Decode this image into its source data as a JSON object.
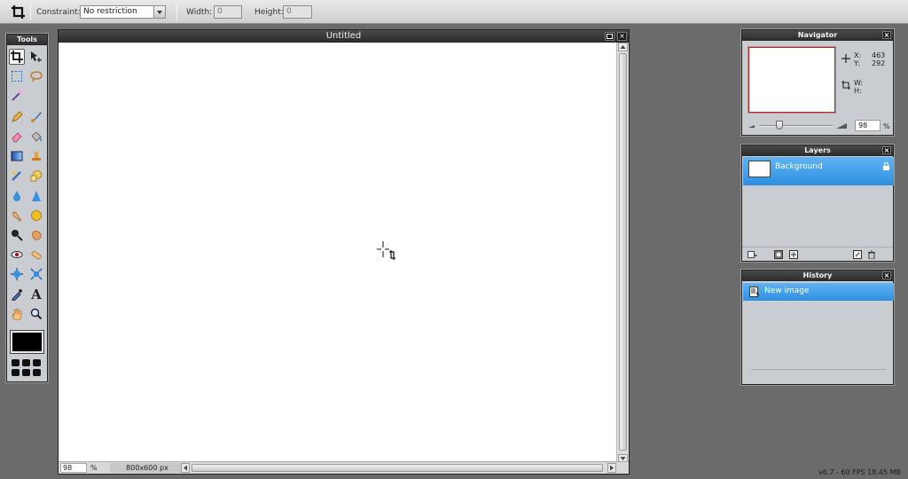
{
  "options_bar": {
    "constraint_label": "Constraint:",
    "constraint_value": "No restriction",
    "width_label": "Width:",
    "width_value": "0",
    "height_label": "Height:",
    "height_value": "0"
  },
  "tools": {
    "title": "Tools",
    "items": [
      "crop",
      "move",
      "marquee",
      "lasso",
      "magic-wand",
      "pencil",
      "brush",
      "eraser",
      "spray",
      "gradient",
      "stamp",
      "heal",
      "color-replace",
      "drop",
      "sharpen",
      "smudge",
      "sponge",
      "dodge",
      "burn",
      "red-eye",
      "bloat",
      "pinch",
      "liquify",
      "color-picker",
      "type",
      "hand",
      "zoom"
    ],
    "selected": "crop"
  },
  "document": {
    "title": "Untitled",
    "zoom": "98",
    "zoom_unit": "%",
    "size": "800x600 px"
  },
  "navigator": {
    "title": "Navigator",
    "x_label": "X:",
    "x_value": "463",
    "y_label": "Y:",
    "y_value": "292",
    "w_label": "W:",
    "h_label": "H:",
    "zoom_value": "98",
    "zoom_unit": "%"
  },
  "layers": {
    "title": "Layers",
    "items": [
      {
        "name": "Background"
      }
    ]
  },
  "history": {
    "title": "History",
    "items": [
      {
        "name": "New image"
      }
    ]
  },
  "status": {
    "version": "v6.7 - 60 FPS 18.45 MB"
  },
  "colors": {
    "background": "#6b6b6b",
    "panel": "#c9ccd1",
    "selection": "#3f9ceb",
    "header": "#2f2f2f"
  }
}
